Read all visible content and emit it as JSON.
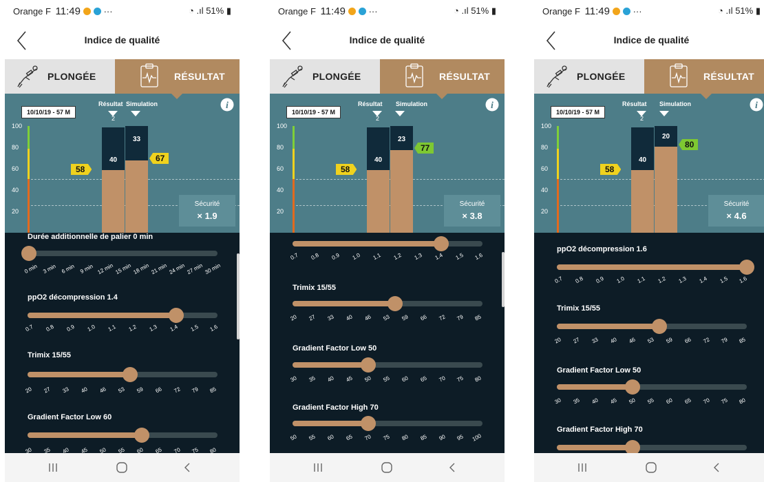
{
  "screens": [
    {
      "status": {
        "carrier": "Orange F",
        "time": "11:49",
        "battery": "51%"
      },
      "title": "Indice de qualité",
      "tabs": [
        {
          "label": "PLONGÉE",
          "icon": "diver-icon"
        },
        {
          "label": "RÉSULTAT",
          "icon": "clipboard-pulse-icon"
        }
      ],
      "chart": {
        "date_badge": "10/10/19 - 57 M",
        "col_result": "Résultat",
        "col_simulation": "Simulation",
        "result_rank": "2",
        "scale_labels": [
          "100",
          "80",
          "60",
          "40",
          "20"
        ],
        "result_value": "58",
        "result_residual": "40",
        "simulation_value": "67",
        "simulation_residual": "33",
        "result_level": 58,
        "simulation_level": 67,
        "simulation_color": "#f0d21e",
        "security_label": "Sécurité",
        "security_value": "× 1.9"
      },
      "settings": [
        {
          "label": "Durée additionnelle de palier 0 min",
          "ticks": [
            "0 min",
            "3 min",
            "6 min",
            "9 min",
            "12 min",
            "15 min",
            "18 min",
            "21 min",
            "24 min",
            "27 min",
            "30 min"
          ],
          "fraction": 0.0
        },
        {
          "label": "ppO2 décompression 1.4",
          "ticks": [
            "0.7",
            "0.8",
            "0.9",
            "1.0",
            "1.1",
            "1.2",
            "1.3",
            "1.4",
            "1.5",
            "1.6"
          ],
          "fraction": 0.78
        },
        {
          "label": "Trimix 15/55",
          "ticks": [
            "20",
            "27",
            "33",
            "40",
            "46",
            "53",
            "59",
            "66",
            "72",
            "79",
            "85"
          ],
          "fraction": 0.54
        },
        {
          "label": "Gradient Factor Low  60",
          "ticks": [
            "30",
            "35",
            "40",
            "45",
            "50",
            "55",
            "60",
            "65",
            "70",
            "75",
            "80"
          ],
          "fraction": 0.6
        }
      ]
    },
    {
      "status": {
        "carrier": "Orange F",
        "time": "11:49",
        "battery": "51%"
      },
      "title": "Indice de qualité",
      "tabs": [
        {
          "label": "PLONGÉE",
          "icon": "diver-icon"
        },
        {
          "label": "RÉSULTAT",
          "icon": "clipboard-pulse-icon"
        }
      ],
      "chart": {
        "date_badge": "10/10/19 - 57 M",
        "col_result": "Résultat",
        "col_simulation": "Simulation",
        "result_rank": "2",
        "scale_labels": [
          "100",
          "80",
          "60",
          "40",
          "20"
        ],
        "result_value": "58",
        "result_residual": "40",
        "simulation_value": "77",
        "simulation_residual": "23",
        "result_level": 58,
        "simulation_level": 77,
        "simulation_color": "#7ec832",
        "security_label": "Sécurité",
        "security_value": "× 3.8"
      },
      "settings": [
        {
          "label": "",
          "ticks": [
            "0.7",
            "0.8",
            "0.9",
            "1.0",
            "1.1",
            "1.2",
            "1.3",
            "1.4",
            "1.5",
            "1.6"
          ],
          "fraction": 0.78
        },
        {
          "label": "Trimix 15/55",
          "ticks": [
            "20",
            "27",
            "33",
            "40",
            "46",
            "53",
            "59",
            "66",
            "72",
            "79",
            "85"
          ],
          "fraction": 0.54
        },
        {
          "label": "Gradient Factor Low  50",
          "ticks": [
            "30",
            "35",
            "40",
            "45",
            "50",
            "55",
            "60",
            "65",
            "70",
            "75",
            "80"
          ],
          "fraction": 0.4
        },
        {
          "label": "Gradient Factor High  70",
          "ticks": [
            "50",
            "55",
            "60",
            "65",
            "70",
            "75",
            "80",
            "85",
            "90",
            "95",
            "100"
          ],
          "fraction": 0.4
        }
      ]
    },
    {
      "status": {
        "carrier": "Orange F",
        "time": "11:49",
        "battery": "51%"
      },
      "title": "Indice de qualité",
      "tabs": [
        {
          "label": "PLONGÉE",
          "icon": "diver-icon"
        },
        {
          "label": "RÉSULTAT",
          "icon": "clipboard-pulse-icon"
        }
      ],
      "chart": {
        "date_badge": "10/10/19 - 57 M",
        "col_result": "Résultat",
        "col_simulation": "Simulation",
        "result_rank": "2",
        "scale_labels": [
          "100",
          "80",
          "60",
          "40",
          "20"
        ],
        "result_value": "58",
        "result_residual": "40",
        "simulation_value": "80",
        "simulation_residual": "20",
        "result_level": 58,
        "simulation_level": 80,
        "simulation_color": "#7ec832",
        "security_label": "Sécurité",
        "security_value": "× 4.6"
      },
      "settings": [
        {
          "label": "ppO2 décompression 1.6",
          "ticks": [
            "0.7",
            "0.8",
            "0.9",
            "1.0",
            "1.1",
            "1.2",
            "1.3",
            "1.4",
            "1.5",
            "1.6"
          ],
          "fraction": 1.0
        },
        {
          "label": "Trimix 15/55",
          "ticks": [
            "20",
            "27",
            "33",
            "40",
            "46",
            "53",
            "59",
            "66",
            "72",
            "79",
            "85"
          ],
          "fraction": 0.54
        },
        {
          "label": "Gradient Factor Low  50",
          "ticks": [
            "30",
            "35",
            "40",
            "45",
            "50",
            "55",
            "60",
            "65",
            "70",
            "75",
            "80"
          ],
          "fraction": 0.4
        },
        {
          "label": "Gradient Factor High  70",
          "ticks": [],
          "fraction": 0.4
        }
      ]
    }
  ],
  "colors": {
    "accent": "#b18a60",
    "chart_bg": "#4d7d88",
    "dark_bar": "#102a3a",
    "result_flag": "#f0d21e"
  }
}
